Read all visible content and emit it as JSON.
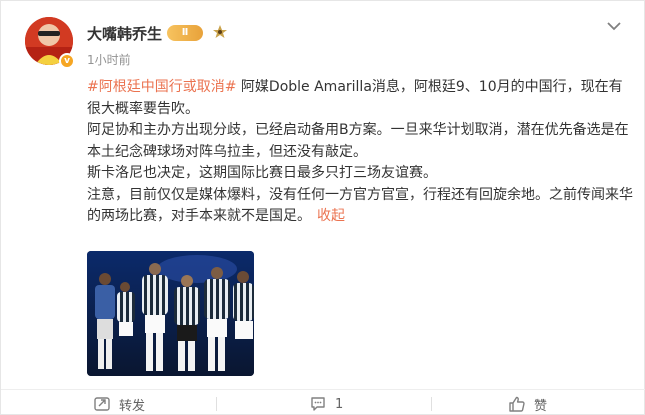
{
  "user": {
    "name": "大嘴韩乔生",
    "vip_level": "Ⅱ",
    "time": "1小时前",
    "avatar_badge": "v"
  },
  "post": {
    "hashtag": "#阿根廷中国行或取消#",
    "p1_rest": " 阿媒Doble Amarilla消息，阿根廷9、10月的中国行，现在有很大概率要告吹。",
    "p2": "阿足协和主办方出现分歧，已经启动备用B方案。一旦来华计划取消，潜在优先备选是在本土纪念碑球场对阵乌拉圭，但还没有敲定。",
    "p3": "斯卡洛尼也决定，这期国际比赛日最多只打三场友谊赛。",
    "p4": "注意，目前仅仅是媒体爆料，没有任何一方官方官宣，行程还有回旋余地。之前传闻来华的两场比赛，对手本来就不是国足。",
    "collapse_label": "收起"
  },
  "actions": {
    "repost_label": "转发",
    "comment_count": "1",
    "like_label": "赞"
  },
  "colors": {
    "accent": "#eb7350",
    "muted": "#939393"
  },
  "icons": [
    "chevron-down-icon",
    "fan-icon",
    "repost-icon",
    "comment-icon",
    "like-icon"
  ]
}
